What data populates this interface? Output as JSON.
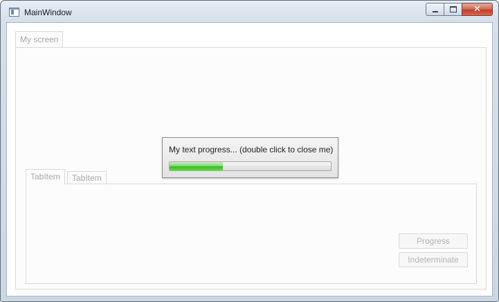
{
  "window": {
    "title": "MainWindow",
    "app_icon": "window-app-icon",
    "caption_buttons": {
      "minimize_icon": "minimize-icon",
      "maximize_icon": "maximize-icon",
      "close_icon": "close-icon",
      "close_glyph": "✕"
    }
  },
  "outer_tab": {
    "label": "My screen"
  },
  "inner_tabs": [
    {
      "label": "TabItem"
    },
    {
      "label": "TabItem"
    }
  ],
  "buttons": {
    "progress": "Progress",
    "indeterminate": "Indeterminate"
  },
  "popup": {
    "text": "My text progress... (double click to close me)",
    "progress_fraction": 0.33
  },
  "colors": {
    "progress_green": "#36c21d",
    "close_red": "#c2402a",
    "disabled_text": "#a7a7a7"
  }
}
